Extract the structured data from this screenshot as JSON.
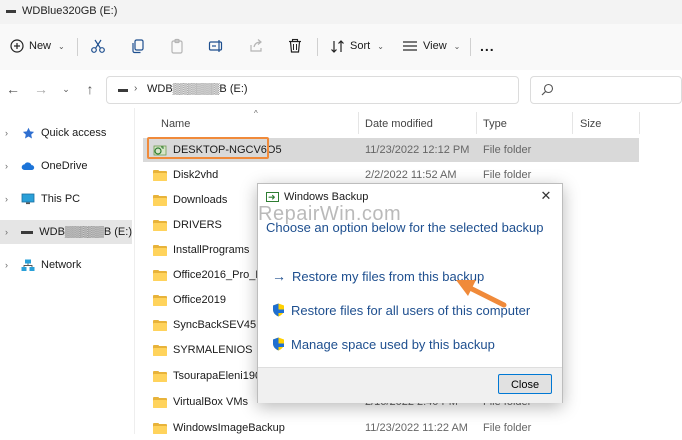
{
  "window": {
    "title": "WDBlue320GB (E:)"
  },
  "toolbar": {
    "new_label": "New",
    "sort_label": "Sort",
    "view_label": "View",
    "more_label": "..."
  },
  "address": {
    "crumb": "WDB▒▒▒▒▒▒B (E:)"
  },
  "sidebar": {
    "items": [
      {
        "label": "Quick access",
        "icon": "star-icon"
      },
      {
        "label": "OneDrive",
        "icon": "cloud-icon"
      },
      {
        "label": "This PC",
        "icon": "monitor-icon"
      },
      {
        "label": "WDB▒▒▒▒▒B (E:)",
        "icon": "drive-icon"
      },
      {
        "label": "Network",
        "icon": "network-icon"
      }
    ]
  },
  "columns": {
    "name": "Name",
    "date": "Date modified",
    "type": "Type",
    "size": "Size"
  },
  "files": [
    {
      "name": "DESKTOP-NGCV6O5",
      "date": "11/23/2022 12:12 PM",
      "type": "File folder",
      "icon": "backup-folder-icon"
    },
    {
      "name": "Disk2vhd",
      "date": "2/2/2022 11:52 AM",
      "type": "File folder",
      "icon": "folder-icon"
    },
    {
      "name": "Downloads",
      "date": "",
      "type": "",
      "icon": "folder-icon"
    },
    {
      "name": "DRIVERS",
      "date": "",
      "type": "",
      "icon": "folder-icon"
    },
    {
      "name": "InstallPrograms",
      "date": "",
      "type": "",
      "icon": "folder-icon"
    },
    {
      "name": "Office2016_Pro_Plus_",
      "date": "",
      "type": "",
      "icon": "folder-icon"
    },
    {
      "name": "Office2019",
      "date": "",
      "type": "",
      "icon": "folder-icon"
    },
    {
      "name": "SyncBackSEV45160",
      "date": "",
      "type": "",
      "icon": "folder-icon"
    },
    {
      "name": "SYRMALENIOS",
      "date": "",
      "type": "",
      "icon": "folder-icon"
    },
    {
      "name": "TsourapaEleni190920",
      "date": "",
      "type": "",
      "icon": "folder-icon"
    },
    {
      "name": "VirtualBox VMs",
      "date": "2/16/2022 2:40 PM",
      "type": "File folder",
      "icon": "folder-icon"
    },
    {
      "name": "WindowsImageBackup",
      "date": "11/23/2022 11:22 AM",
      "type": "File folder",
      "icon": "folder-icon"
    }
  ],
  "dialog": {
    "title": "Windows Backup",
    "watermark": "RepairWin.com",
    "instruction": "Choose an option below for the selected backup",
    "options": [
      {
        "label": "Restore my files from this backup",
        "icon": "arrow-right-icon"
      },
      {
        "label": "Restore files for all users of this computer",
        "icon": "shield-icon"
      },
      {
        "label": "Manage space used by this backup",
        "icon": "shield-icon"
      }
    ],
    "close_label": "Close"
  },
  "colors": {
    "accent": "#0078d4",
    "link": "#1e4f8f",
    "callout": "#f08a3a"
  }
}
